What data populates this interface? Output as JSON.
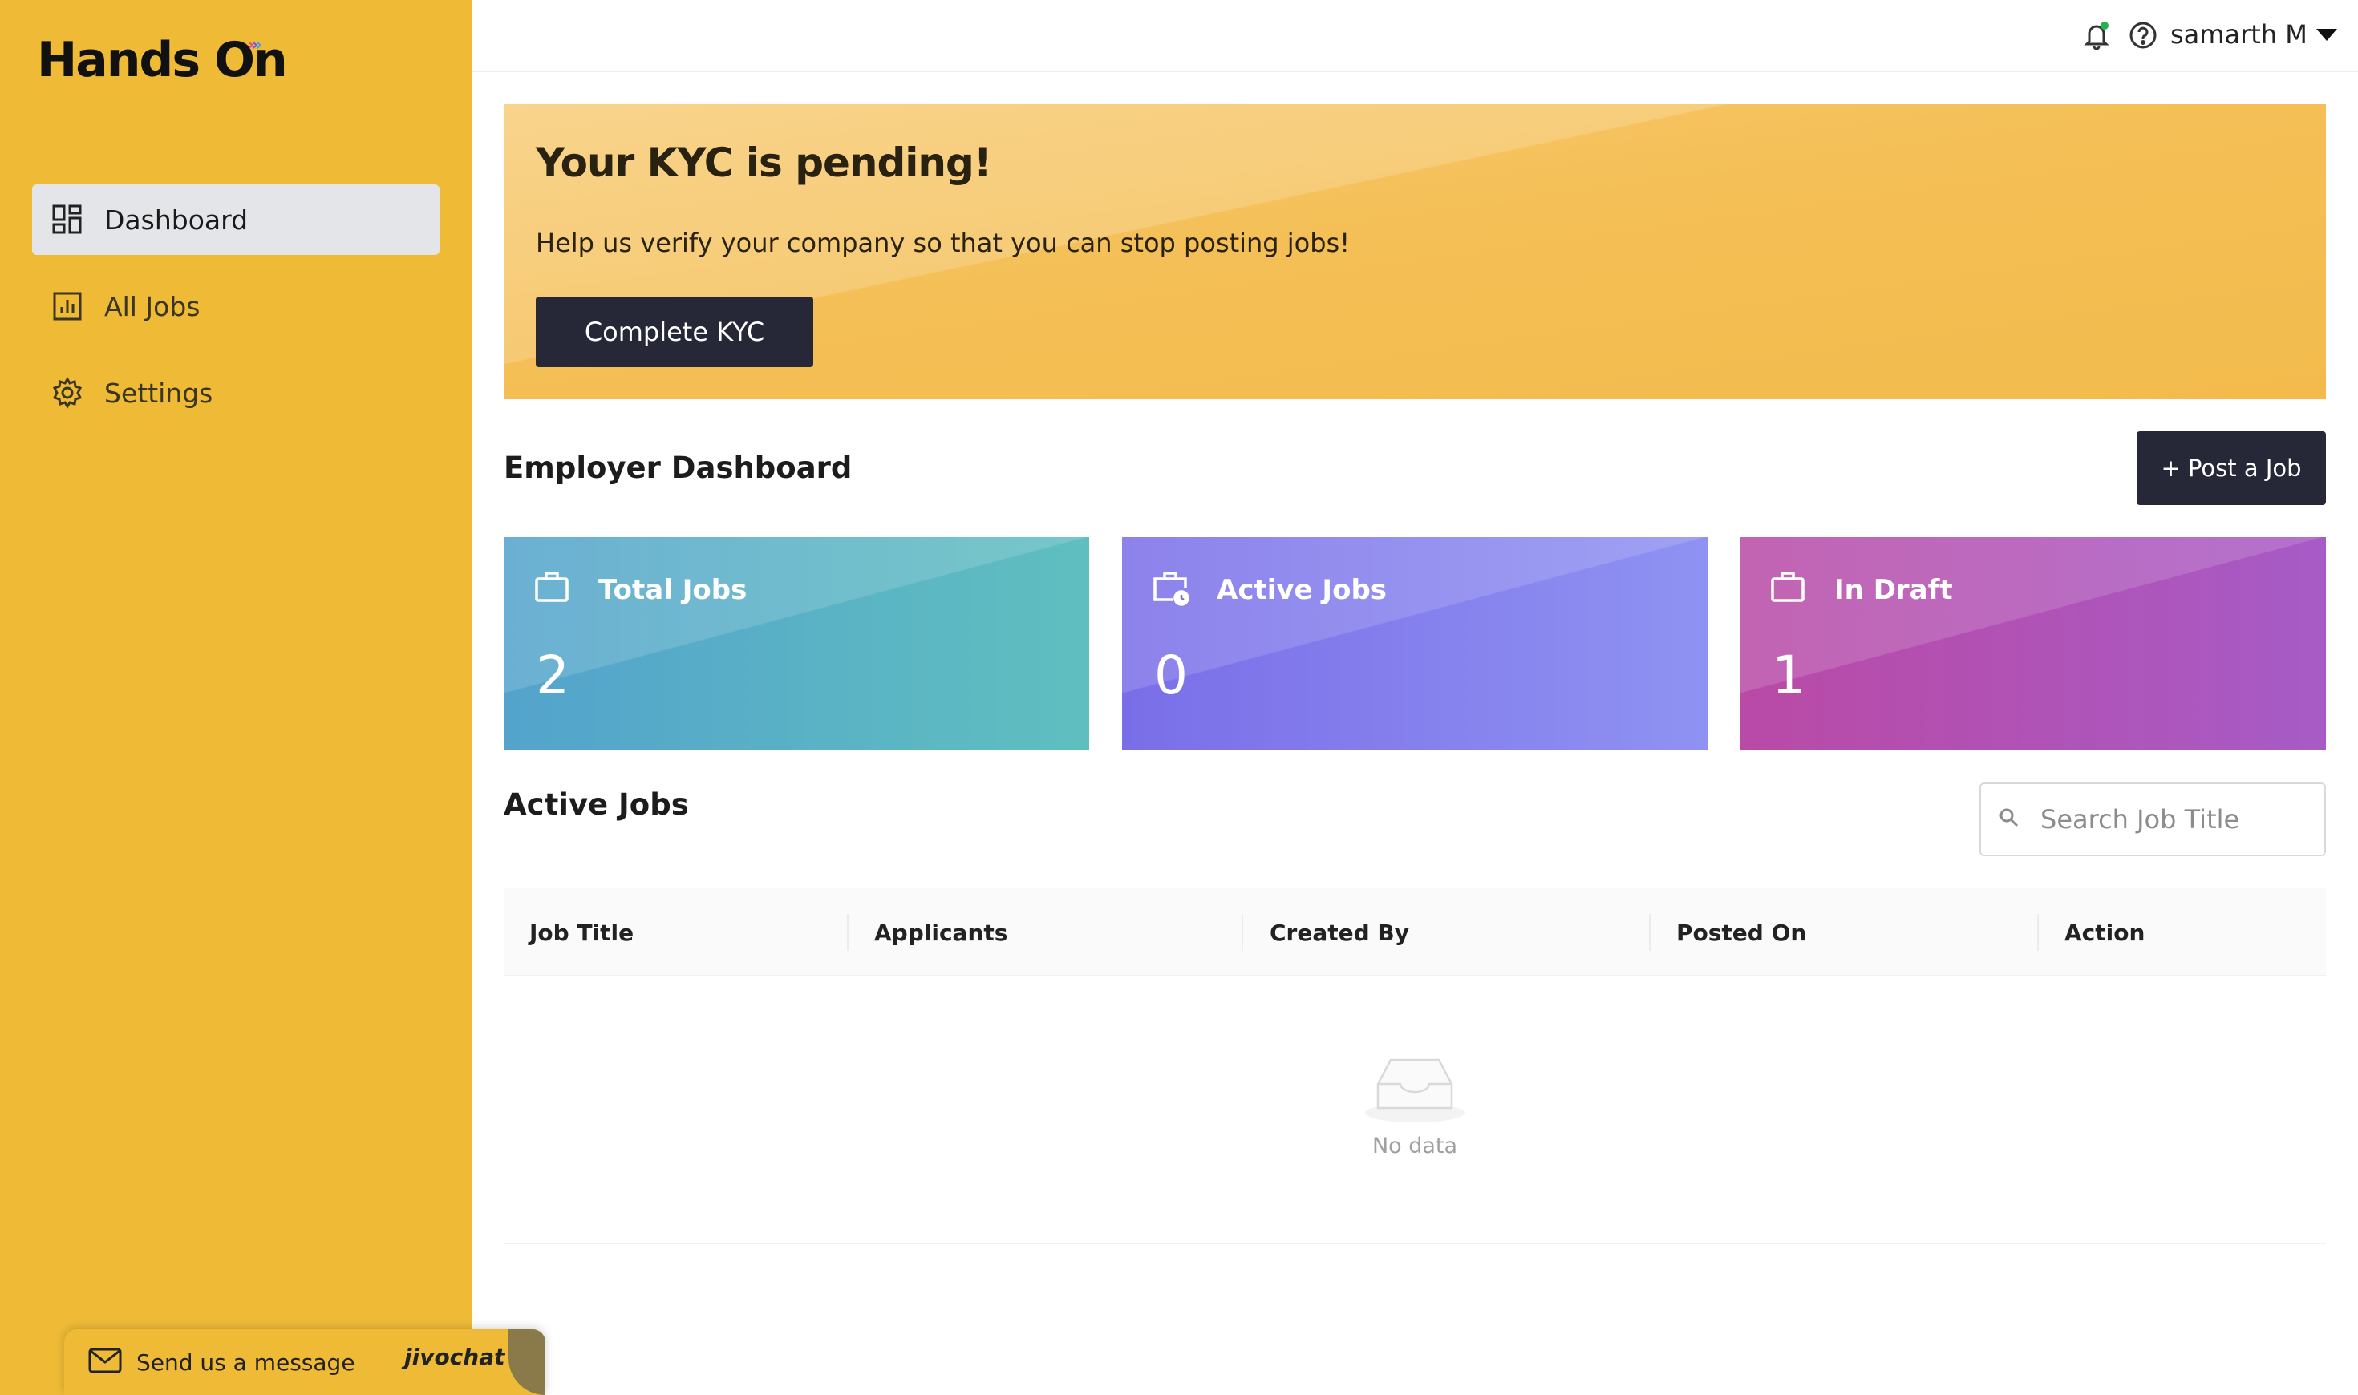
{
  "app": {
    "logo_text": "Hands On"
  },
  "sidebar": {
    "items": [
      {
        "label": "Dashboard",
        "icon": "dashboard-icon",
        "active": true
      },
      {
        "label": "All Jobs",
        "icon": "bar-chart-icon",
        "active": false
      },
      {
        "label": "Settings",
        "icon": "gear-icon",
        "active": false
      }
    ]
  },
  "header": {
    "user_name": "samarth M",
    "notification_dot_color": "#22b14c"
  },
  "kyc": {
    "title": "Your KYC is pending!",
    "message": "Help us verify your company so that you can stop posting jobs!",
    "button_label": "Complete KYC"
  },
  "dashboard": {
    "title": "Employer Dashboard",
    "post_button_label": "+ Post a Job",
    "stats": [
      {
        "label": "Total Jobs",
        "value": "2",
        "icon": "briefcase-icon"
      },
      {
        "label": "Active Jobs",
        "value": "0",
        "icon": "briefcase-clock-icon"
      },
      {
        "label": "In Draft",
        "value": "1",
        "icon": "briefcase-icon"
      }
    ]
  },
  "active_jobs": {
    "title": "Active Jobs",
    "search_placeholder": "Search Job Title",
    "columns": [
      "Job Title",
      "Applicants",
      "Created By",
      "Posted On",
      "Action"
    ],
    "rows": [],
    "empty_text": "No data"
  },
  "chat": {
    "label": "Send us a message",
    "brand": "jivochat"
  },
  "colors": {
    "sidebar_bg": "#efbb37",
    "button_dark": "#262837"
  }
}
